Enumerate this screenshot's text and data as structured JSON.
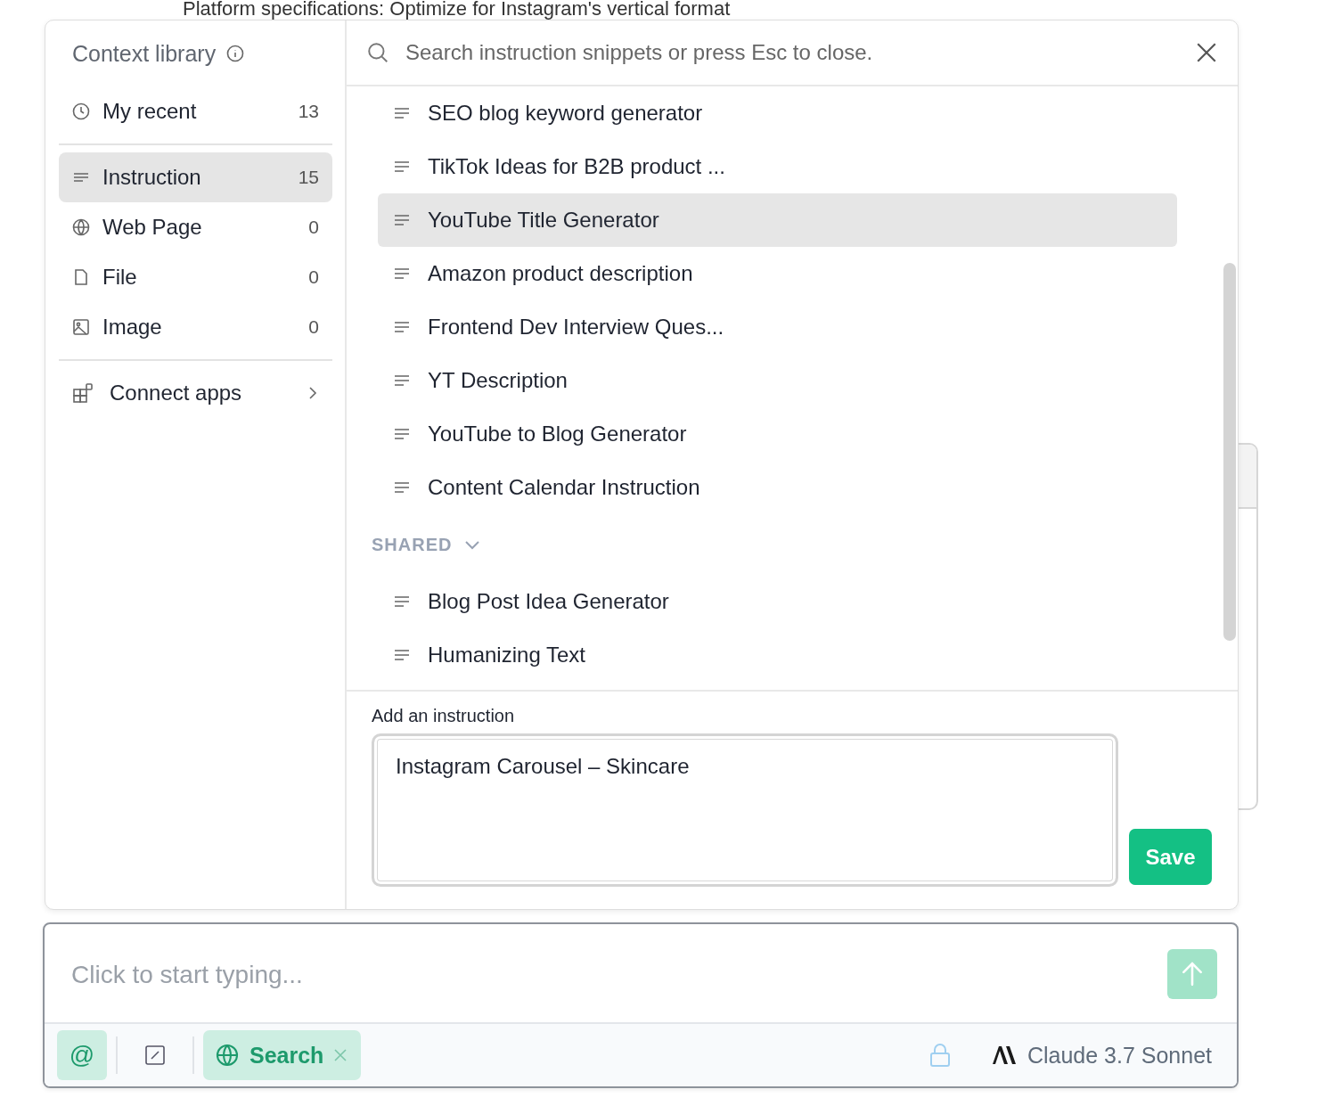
{
  "background_text": "Platform specifications: Optimize for Instagram's vertical format",
  "sidebar": {
    "title": "Context library",
    "recent": {
      "kind": "clock",
      "label": "My recent",
      "count": "13",
      "selected": false
    },
    "items": [
      {
        "kind": "lines",
        "label": "Instruction",
        "count": "15",
        "selected": true
      },
      {
        "kind": "globe",
        "label": "Web Page",
        "count": "0",
        "selected": false
      },
      {
        "kind": "file",
        "label": "File",
        "count": "0",
        "selected": false
      },
      {
        "kind": "image",
        "label": "Image",
        "count": "0",
        "selected": false
      }
    ],
    "connect": "Connect apps"
  },
  "search": {
    "placeholder": "Search instruction snippets or press Esc to close."
  },
  "snippets": [
    {
      "label": "SEO blog keyword generator",
      "selected": false
    },
    {
      "label": "TikTok Ideas for B2B product ...",
      "selected": false
    },
    {
      "label": "YouTube Title Generator",
      "selected": true
    },
    {
      "label": "Amazon product description",
      "selected": false
    },
    {
      "label": "Frontend Dev Interview Ques...",
      "selected": false
    },
    {
      "label": "YT Description",
      "selected": false
    },
    {
      "label": "YouTube to Blog Generator",
      "selected": false
    },
    {
      "label": "Content Calendar Instruction",
      "selected": false
    }
  ],
  "shared": {
    "label": "SHARED",
    "expanded": true,
    "items": [
      {
        "label": "Blog Post Idea Generator",
        "selected": false
      },
      {
        "label": "Humanizing Text",
        "selected": false
      }
    ]
  },
  "add_instruction": {
    "label": "Add an instruction",
    "value": "Instagram Carousel – Skincare",
    "button": "Save"
  },
  "composer": {
    "placeholder": "Click to start typing...",
    "mention": "@",
    "mention_on": true,
    "search_chip": "Search",
    "search_on": true,
    "model": "Claude 3.7 Sonnet"
  }
}
